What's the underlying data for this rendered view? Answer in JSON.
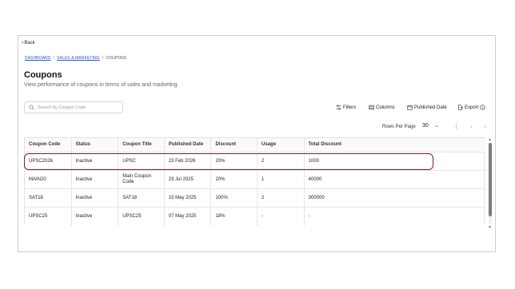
{
  "back_label": "Back",
  "breadcrumb": {
    "items": [
      "DASHBOARD",
      "SALES & MARKETING",
      "COUPONS"
    ],
    "sep": "/"
  },
  "page": {
    "title": "Coupons",
    "subtitle": "View performance of coupons in terms of sales and marketing."
  },
  "search": {
    "placeholder": "Search by Coupon Code",
    "value": ""
  },
  "toolbar": {
    "filters": "Filters",
    "columns": "Columns",
    "published_date": "Published Date",
    "export": "Export"
  },
  "pagination": {
    "rows_label": "Rows Per Page",
    "rows_value": "30"
  },
  "table": {
    "headers": [
      "Coupon Code",
      "Status",
      "Coupon Title",
      "Published Date",
      "Discount",
      "Usage",
      "Total Discount"
    ],
    "rows": [
      [
        "UPSC2026",
        "Inactive",
        "UPSC",
        "23 Feb 2026",
        "20%",
        "2",
        "1000"
      ],
      [
        "MAIN20",
        "Inactive",
        "Main Coupon Code",
        "23 Jul 2025",
        "20%",
        "1",
        "40000"
      ],
      [
        "SAT18",
        "Inactive",
        "SAT18",
        "15 May 2025",
        "100%",
        "2",
        "300000"
      ],
      [
        "UPSC25",
        "Inactive",
        "UPSC25",
        "07 May 2025",
        "18%",
        "-",
        "-"
      ]
    ]
  },
  "colors": {
    "link": "#2a55c9",
    "highlight": "#8b1a1a",
    "border": "#cfcfcf"
  }
}
